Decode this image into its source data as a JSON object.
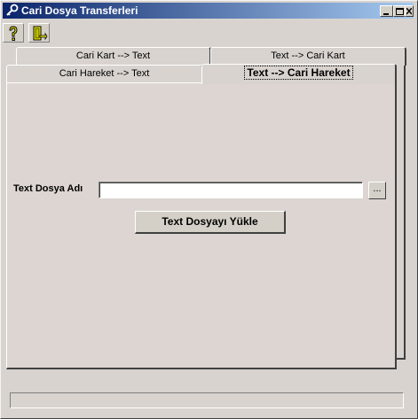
{
  "window": {
    "title": "Cari Dosya Transferleri",
    "title_icon": "key-search-icon",
    "buttons": [
      "minimize",
      "maximize",
      "close"
    ]
  },
  "toolbar": {
    "help_icon": "help-question-icon",
    "exit_icon": "exit-door-icon"
  },
  "tabs": {
    "row_back": [
      "Cari Kart --> Text",
      "Text --> Cari Kart"
    ],
    "row_front": [
      "Cari Hareket --> Text",
      "Text --> Cari Hareket"
    ],
    "active": "Text --> Cari Hareket"
  },
  "form": {
    "file_label": "Text Dosya Adı",
    "file_value": "",
    "browse_label": "...",
    "load_button": "Text Dosyayı Yükle"
  },
  "status": {
    "text": ""
  },
  "colors": {
    "titlebar_start": "#0a246a",
    "titlebar_end": "#a6caf0",
    "face": "#d8d3cf"
  }
}
